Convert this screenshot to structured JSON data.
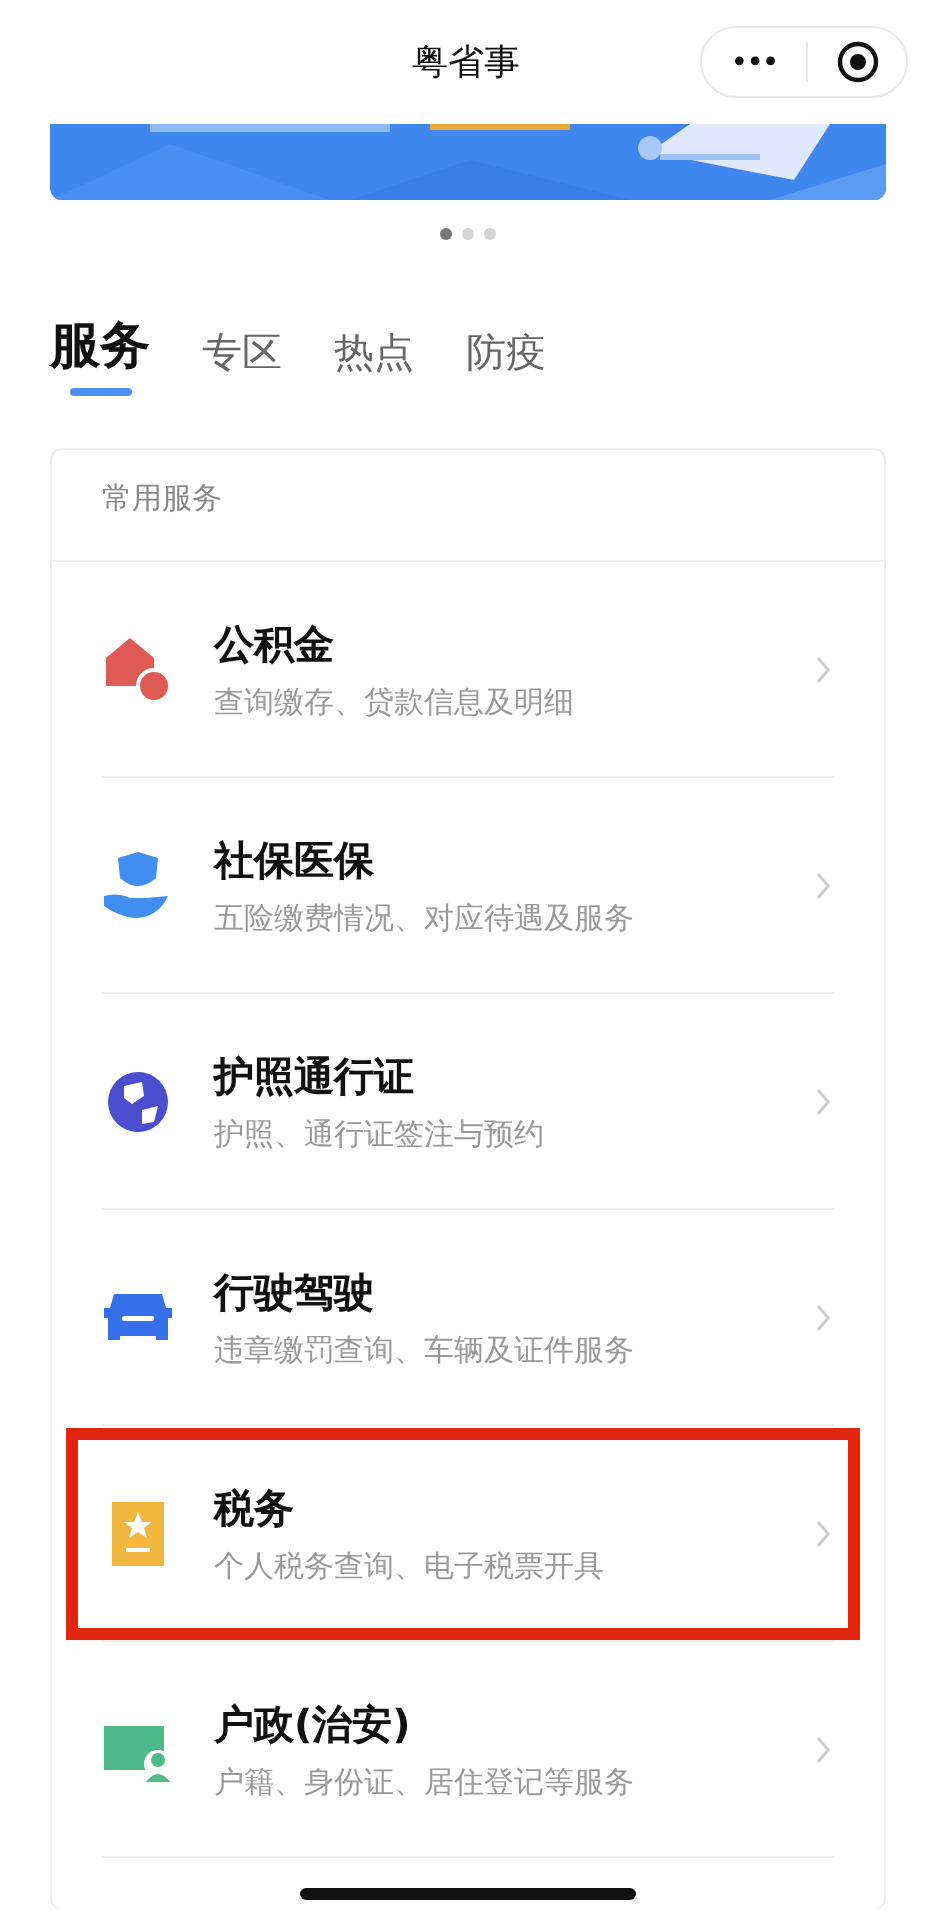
{
  "header": {
    "title": "粤省事",
    "more_button": "•••"
  },
  "banner": {
    "pages": [
      {
        "selected": true
      },
      {
        "selected": false
      },
      {
        "selected": false
      }
    ]
  },
  "tabs": [
    {
      "label": "服务",
      "selected": true
    },
    {
      "label": "专区",
      "selected": false
    },
    {
      "label": "热点",
      "selected": false
    },
    {
      "label": "防疫",
      "selected": false
    }
  ],
  "section": {
    "title": "常用服务",
    "items": [
      {
        "kind": "house",
        "title": "公积金",
        "subtitle": "查询缴存、贷款信息及明细",
        "highlighted": false
      },
      {
        "kind": "person",
        "title": "社保医保",
        "subtitle": "五险缴费情况、对应待遇及服务",
        "highlighted": false
      },
      {
        "kind": "globe",
        "title": "护照通行证",
        "subtitle": "护照、通行证签注与预约",
        "highlighted": false
      },
      {
        "kind": "car",
        "title": "行驶驾驶",
        "subtitle": "违章缴罚查询、车辆及证件服务",
        "highlighted": false
      },
      {
        "kind": "tax",
        "title": "税务",
        "subtitle": "个人税务查询、电子税票开具",
        "highlighted": true
      },
      {
        "kind": "id",
        "title": "户政(治安)",
        "subtitle": "户籍、身份证、居住登记等服务",
        "highlighted": false
      }
    ]
  }
}
